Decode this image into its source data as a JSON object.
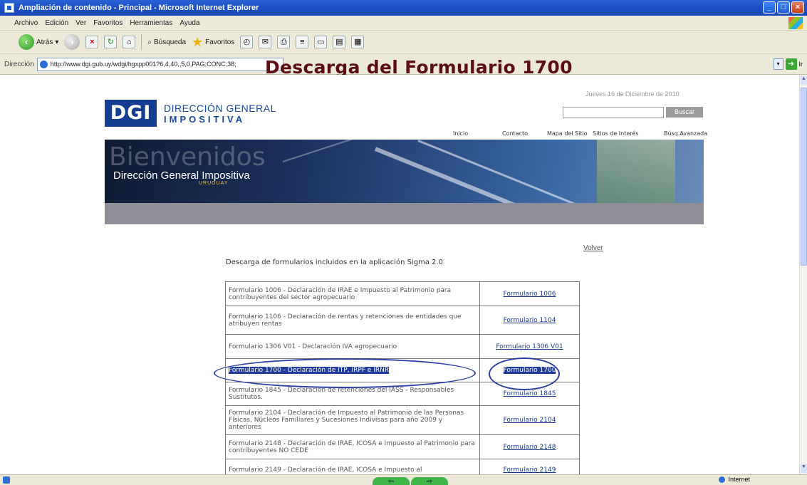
{
  "window": {
    "title": "Ampliación de contenido - Principal - Microsoft Internet Explorer"
  },
  "menu": [
    "Archivo",
    "Edición",
    "Ver",
    "Favoritos",
    "Herramientas",
    "Ayuda"
  ],
  "toolbar": {
    "back_label": "Atrás",
    "search_label": "Búsqueda",
    "favorites_label": "Favoritos"
  },
  "address": {
    "label": "Dirección",
    "url": "http://www.dgi.gub.uy/wdgi/hgxpp001?6,4,40,,5,0,PAG;CONC;38;",
    "go_label": "Ir"
  },
  "overlay_title": "Descarga del Formulario 1700",
  "page": {
    "date": "Jueves 16 de Diciembre de 2010",
    "logo_mark": "DGI",
    "logo_line1": "DIRECCIÓN GENERAL",
    "logo_line2": "IMPOSITIVA",
    "search_button": "Buscar",
    "nav": [
      "Inicio",
      "Contacto",
      "Mapa del Sitio",
      "Sitios de Interés",
      "Búsq.Avanzada"
    ],
    "banner_big": "Bienvenidos",
    "banner_sub": "Dirección General Impositiva",
    "banner_country": "URUGUAY",
    "volver": "Volver",
    "heading": "Descarga de formularios incluidos en la aplicación Sigma 2.0",
    "forms": [
      {
        "desc": "Formulario 1006 - Declaración de IRAE e Impuesto al Patrimonio para contribuyentes del sector agropecuario",
        "link": "Formulario 1006"
      },
      {
        "desc": "Formulario 1106 - Declaración de rentas y retenciones de entidades que atribuyen rentas",
        "link": "Formulario 1104"
      },
      {
        "desc": "Formulario 1306 V01 - Declaración IVA agropecuario",
        "link": "Formulario 1306 V01"
      },
      {
        "desc": "Formulario 1700 - Declaración de ITP, IRPF e IRNR",
        "link": "Formulario 1700"
      },
      {
        "desc": "Formulario 1845 - Declaración de retenciones del IASS - Responsables Sustitutos.",
        "link": "Formulario 1845"
      },
      {
        "desc": "Formulario 2104 - Declaración de Impuesto al Patrimonio de las Personas Físicas, Núcleos Familiares y Sucesiones Indivisas para año 2009 y anteriores",
        "link": "Formulario 2104"
      },
      {
        "desc": "Formulario 2148 - Declaración de IRAE, ICOSA e Impuesto al Patrimonio para contribuyentes NO CEDE",
        "link": "Formulario 2148"
      },
      {
        "desc": "Formulario 2149 - Declaración de IRAE, ICOSA e Impuesto al",
        "link": "Formulario 2149"
      }
    ]
  },
  "status": {
    "zone": "Internet"
  }
}
